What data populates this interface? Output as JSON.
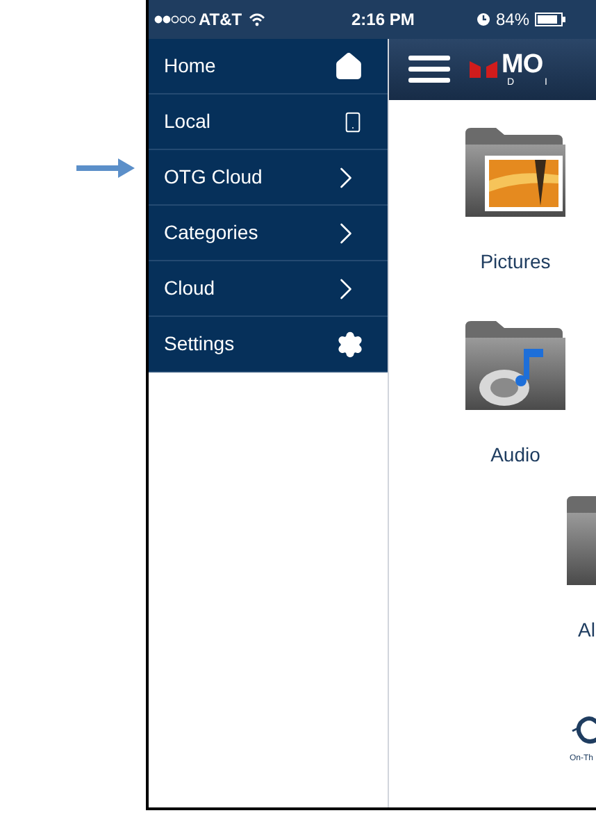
{
  "status_bar": {
    "carrier": "AT&T",
    "time": "2:16 PM",
    "battery": "84%"
  },
  "menu": {
    "items": [
      {
        "label": "Home",
        "kind": "home"
      },
      {
        "label": "Local",
        "kind": "phone"
      },
      {
        "label": "OTG Cloud",
        "kind": "chevron"
      },
      {
        "label": "Categories",
        "kind": "chevron"
      },
      {
        "label": "Cloud",
        "kind": "chevron"
      },
      {
        "label": "Settings",
        "kind": "gear"
      }
    ]
  },
  "header": {
    "logo": "MO",
    "logo_subtitle": "D I"
  },
  "content": {
    "items": [
      {
        "label": "Pictures",
        "kind": "pictures"
      },
      {
        "label": "Audio",
        "kind": "audio"
      },
      {
        "label": "Al",
        "kind": "folder"
      }
    ],
    "footer_logo_text": "On-Th"
  }
}
